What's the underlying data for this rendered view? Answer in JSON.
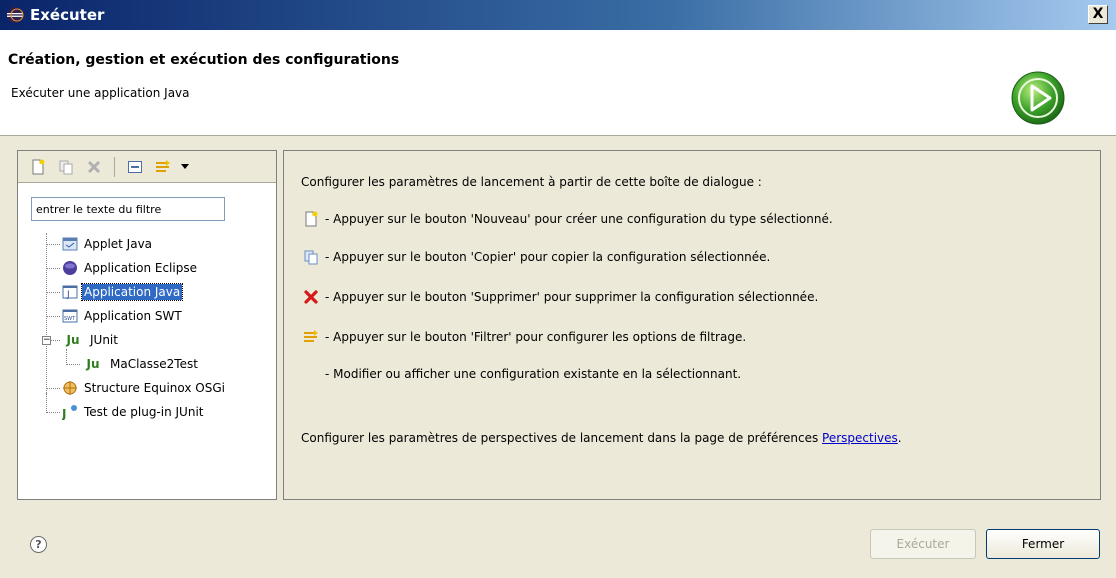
{
  "window": {
    "title": "Exécuter",
    "close_symbol": "X"
  },
  "header": {
    "title": "Création, gestion et exécution des configurations",
    "subtitle": "Exécuter une application Java"
  },
  "left": {
    "filter_placeholder": "entrer le texte du filtre",
    "filter_value": "entrer le texte du filtre",
    "tree": [
      {
        "label": "Applet Java",
        "icon": "applet-icon"
      },
      {
        "label": "Application Eclipse",
        "icon": "eclipse-app-icon"
      },
      {
        "label": "Application Java",
        "icon": "java-app-icon",
        "selected": true
      },
      {
        "label": "Application SWT",
        "icon": "swt-app-icon"
      },
      {
        "label": "JUnit",
        "icon": "junit-icon",
        "expanded": true
      },
      {
        "label": "MaClasse2Test",
        "icon": "junit-icon",
        "child": true
      },
      {
        "label": "Structure Equinox OSGi",
        "icon": "osgi-icon"
      },
      {
        "label": "Test de plug-in JUnit",
        "icon": "junit-plugin-icon"
      }
    ],
    "junit_prefix": "Ju"
  },
  "right": {
    "intro": "Configurer les paramètres de lancement à partir de cette boîte de dialogue :",
    "items": [
      {
        "icon": "new-config-icon",
        "text": "- Appuyer sur le bouton 'Nouveau' pour créer une configuration du type sélectionné."
      },
      {
        "icon": "copy-config-icon",
        "text": "- Appuyer sur le bouton 'Copier' pour copier la configuration sélectionnée."
      },
      {
        "icon": "delete-config-icon",
        "text": "- Appuyer sur le bouton 'Supprimer' pour supprimer la configuration sélectionnée."
      },
      {
        "icon": "filter-config-icon",
        "text": "- Appuyer sur le bouton 'Filtrer' pour configurer les options de filtrage."
      },
      {
        "icon": "",
        "text": "- Modifier ou afficher une configuration existante en la sélectionnant."
      }
    ],
    "footer_text": "Configurer les paramètres de perspectives de lancement dans la page de préférences ",
    "footer_link": "Perspectives",
    "footer_end": "."
  },
  "buttons": {
    "run": "Exécuter",
    "close": "Fermer"
  },
  "help": "?",
  "colors": {
    "selection": "#316ac5",
    "link": "#0000cc",
    "run_green": "#3aa02a"
  }
}
